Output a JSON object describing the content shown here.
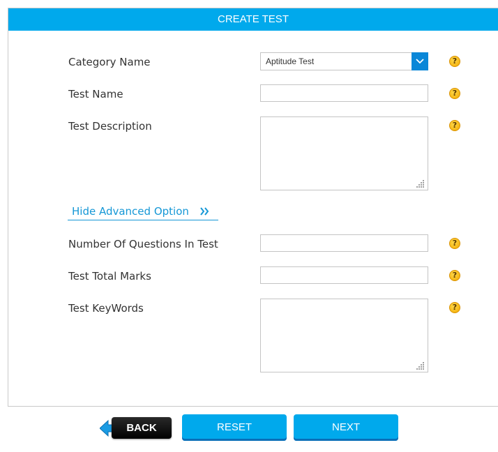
{
  "header": {
    "title": "CREATE TEST"
  },
  "form": {
    "category": {
      "label": "Category Name",
      "value": "Aptitude Test"
    },
    "test_name": {
      "label": "Test Name",
      "value": ""
    },
    "test_description": {
      "label": "Test Description",
      "value": ""
    },
    "advanced_toggle": {
      "label": "Hide Advanced Option",
      "icon": "double-chevron-right-icon"
    },
    "num_questions": {
      "label": "Number Of Questions In Test",
      "value": ""
    },
    "total_marks": {
      "label": "Test Total Marks",
      "value": ""
    },
    "keywords": {
      "label": "Test KeyWords",
      "value": ""
    },
    "help_icon_glyph": "?"
  },
  "actions": {
    "back_label": "BACK",
    "reset_label": "RESET",
    "next_label": "NEXT"
  },
  "colors": {
    "accent": "#00a9ec",
    "select_button": "#0a87d8",
    "link": "#1497d6",
    "help_icon": "#f1a900",
    "back_button": "#000000"
  }
}
